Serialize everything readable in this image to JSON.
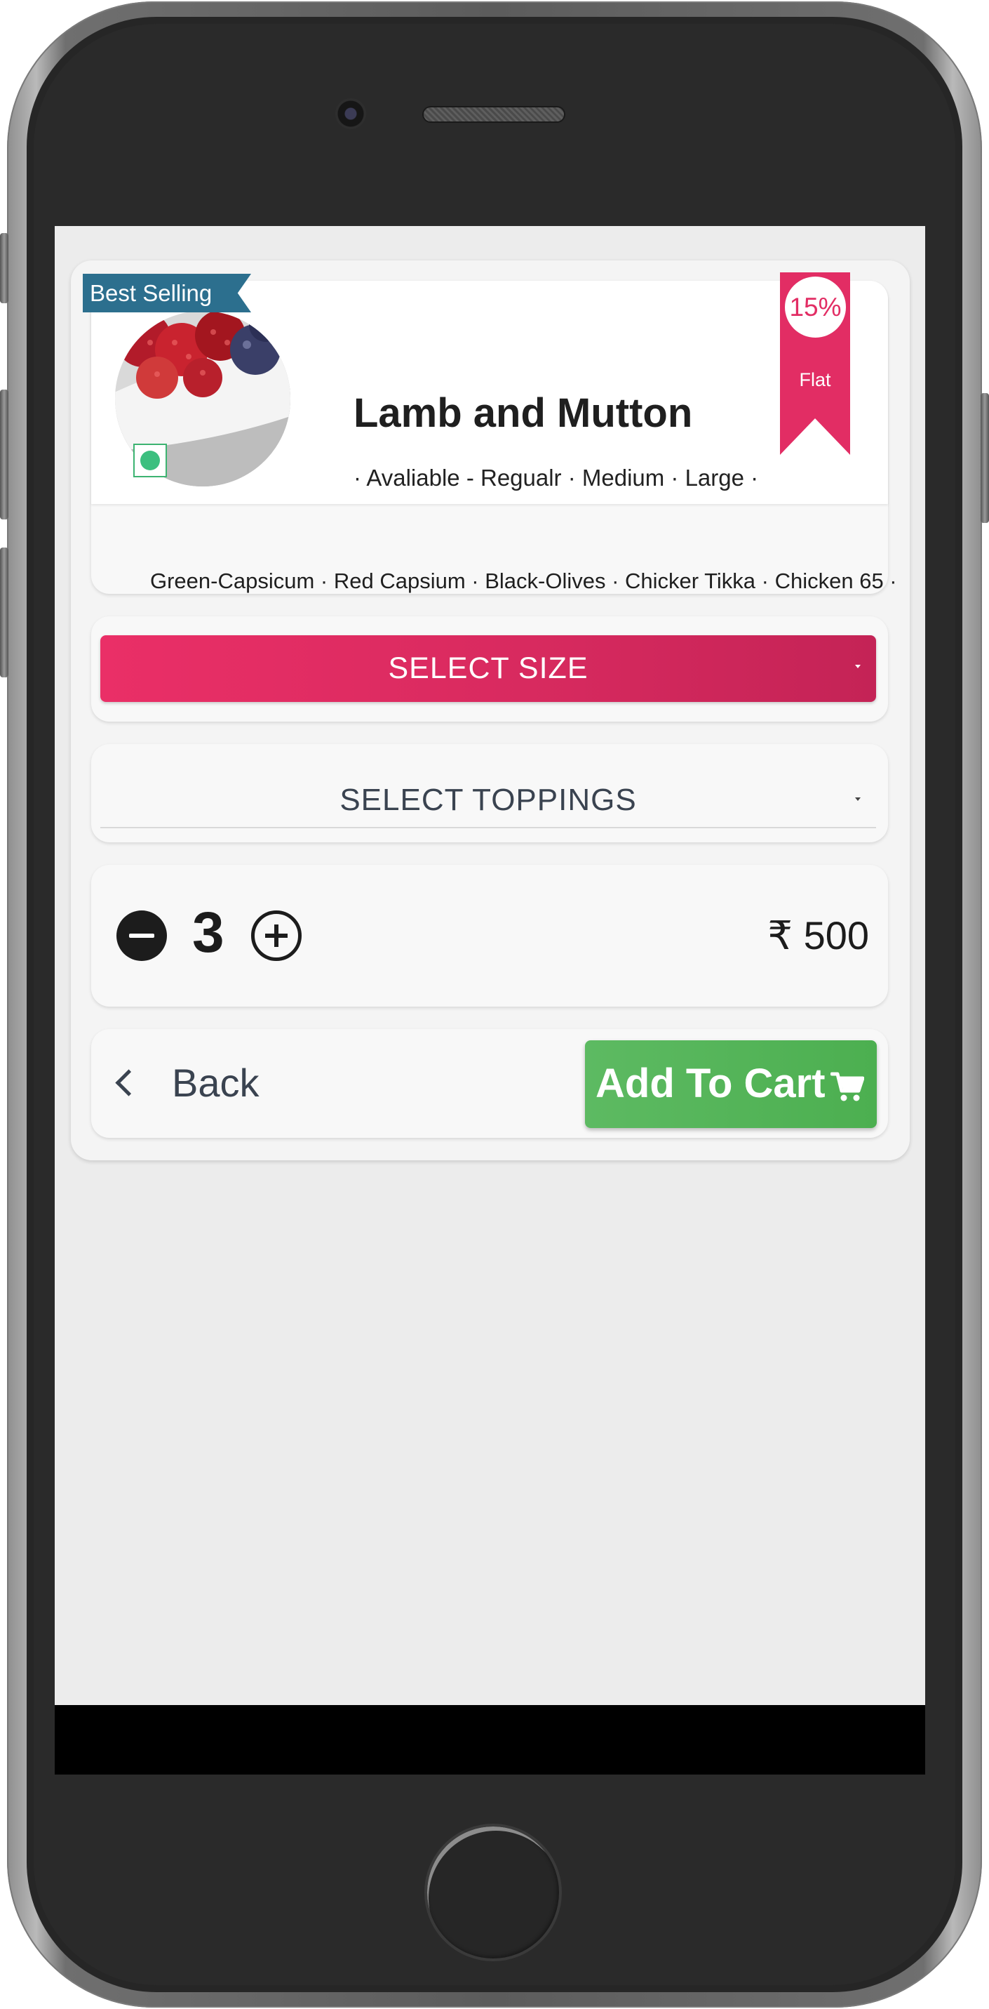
{
  "product": {
    "badge": "Best Selling",
    "name": "Lamb and Mutton",
    "sizes_line": "· Avaliable - Regualr · Medium · Large ·",
    "toppings_line": "Green-Capsicum · Red Capsium · Black-Olives · Chicker Tikka · Chicken 65 ·",
    "discount_percent": "15%",
    "discount_label": "Flat",
    "veg": true
  },
  "select_size": {
    "label": "SELECT SIZE"
  },
  "select_toppings": {
    "label": "SELECT TOPPINGS"
  },
  "quantity": {
    "value": "3"
  },
  "price": {
    "text": "₹ 500"
  },
  "actions": {
    "back_label": "Back",
    "add_to_cart_label": "Add To Cart"
  },
  "icons": {
    "minus": "minus-circle-icon",
    "plus": "plus-circle-icon",
    "back": "chevron-left-icon",
    "cart": "cart-icon",
    "caret": "caret-down-icon"
  },
  "colors": {
    "accent_pink": "#e22d64",
    "cart_green": "#4caf50",
    "ribbon_blue": "#2c6f8e",
    "veg_green": "#3cbf7f"
  }
}
